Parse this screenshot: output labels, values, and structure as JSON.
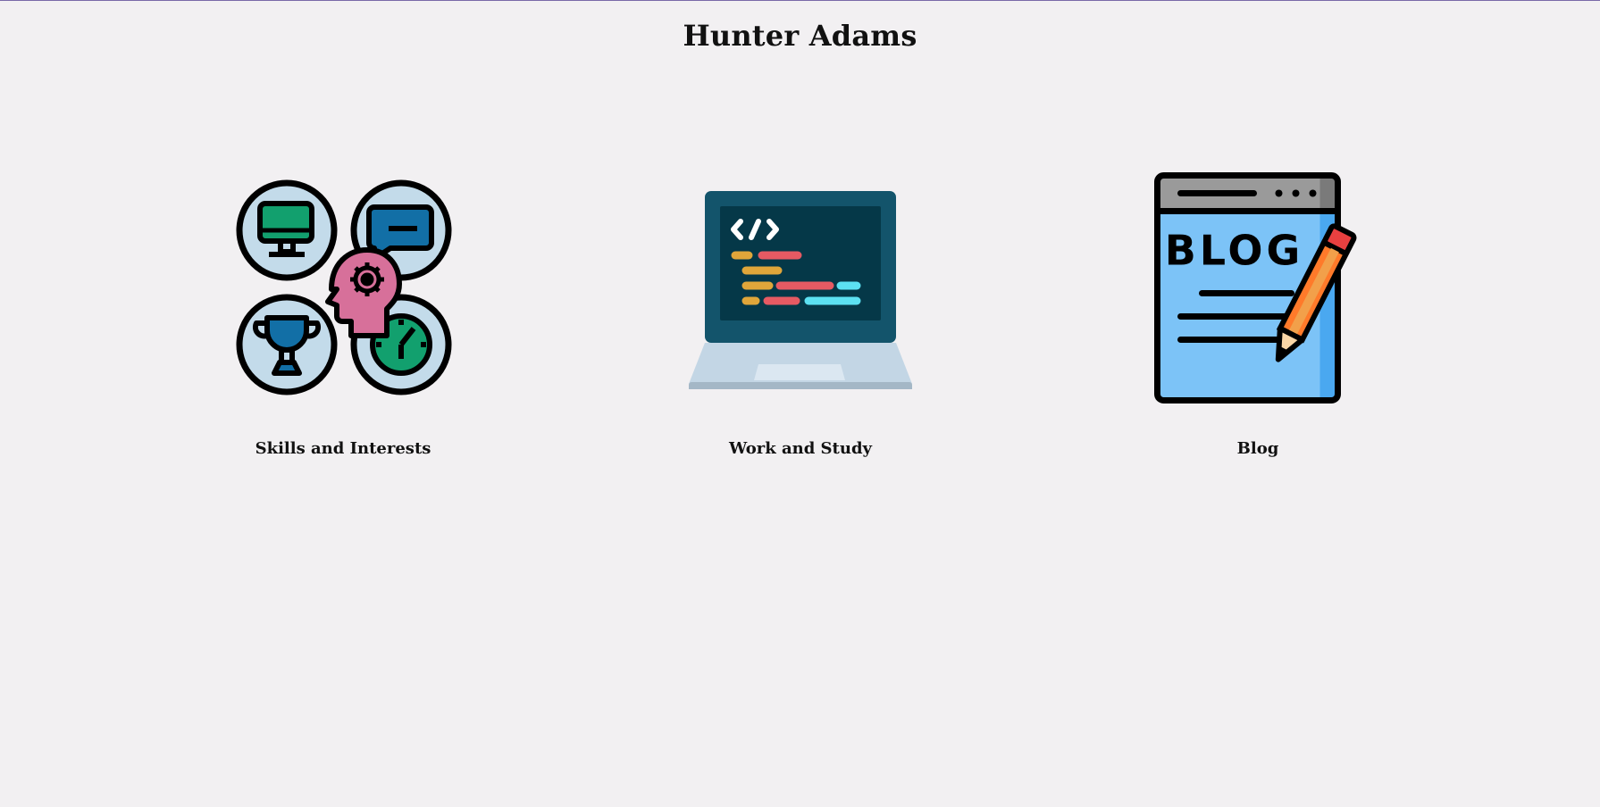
{
  "header": {
    "title": "Hunter Adams"
  },
  "cards": [
    {
      "label": "Skills and Interests",
      "icon": "skills-interests-icon"
    },
    {
      "label": "Work and Study",
      "icon": "laptop-code-icon"
    },
    {
      "label": "Blog",
      "icon": "blog-pencil-icon"
    }
  ],
  "blog_icon_text": "BLOG",
  "colors": {
    "background": "#f2f0f2",
    "text": "#111111",
    "top_border": "#7a6aa8"
  }
}
